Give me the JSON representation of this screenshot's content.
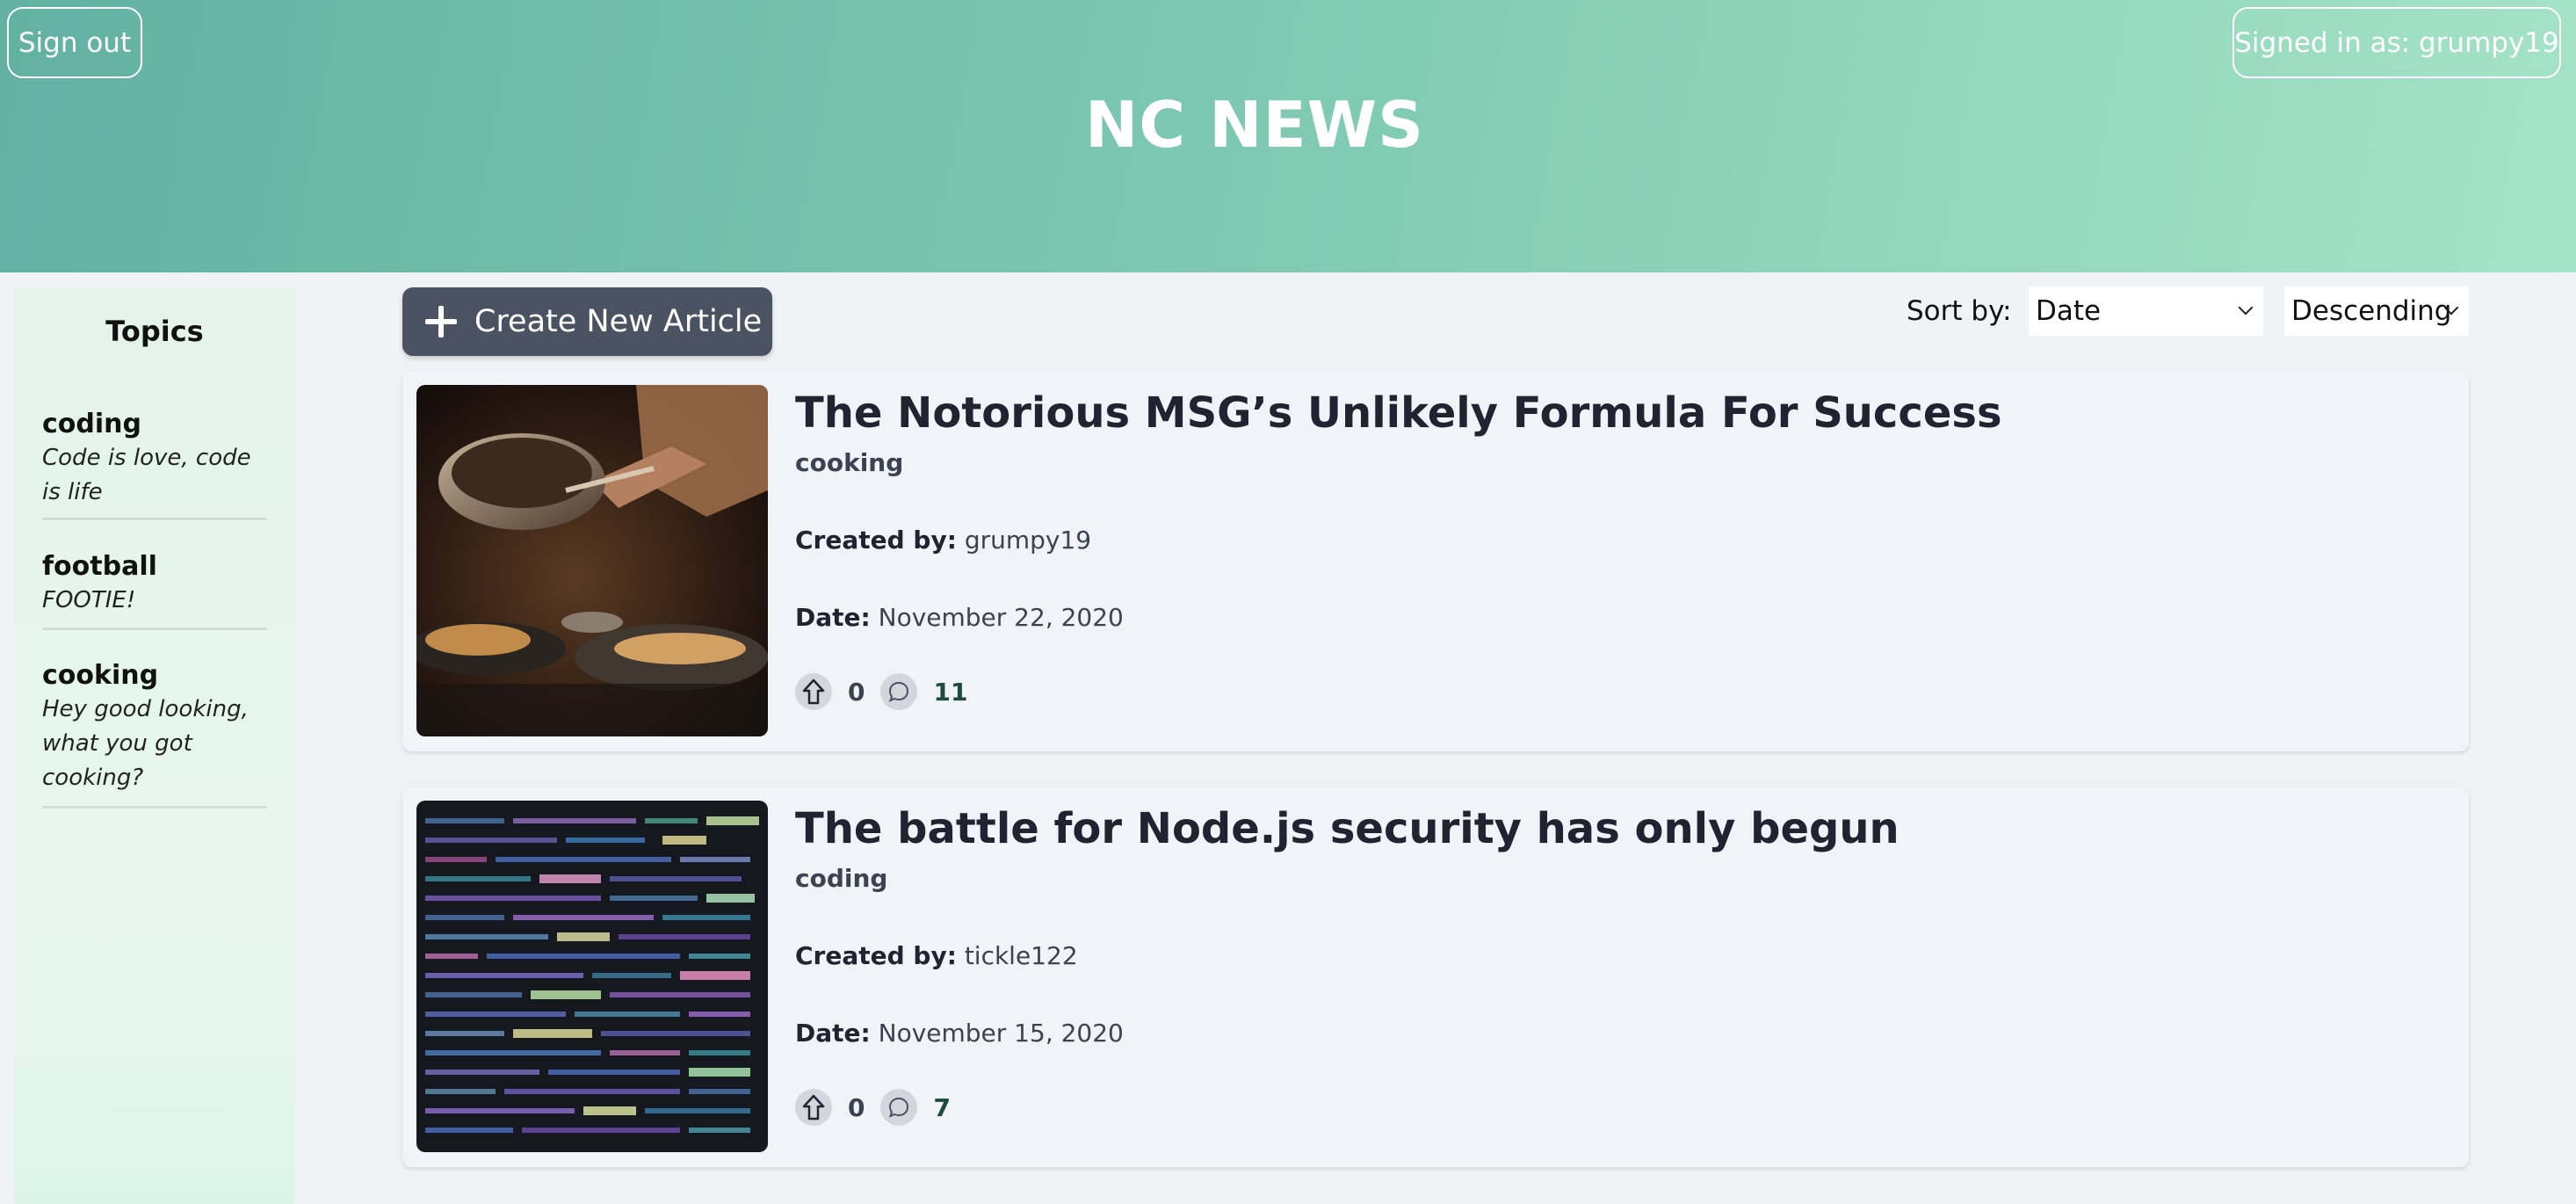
{
  "header": {
    "sign_out": "Sign out",
    "signed_in": "Signed in as: grumpy19",
    "title": "NC NEWS"
  },
  "sidebar": {
    "title": "Topics",
    "topics": [
      {
        "slug": "coding",
        "description": "Code is love, code is life"
      },
      {
        "slug": "football",
        "description": "FOOTIE!"
      },
      {
        "slug": "cooking",
        "description": "Hey good looking, what you got cooking?"
      }
    ]
  },
  "toolbar": {
    "create_label": "Create New Article",
    "sort_label": "Sort by:",
    "sort_field": "Date",
    "sort_order": "Descending"
  },
  "articles": [
    {
      "title": "The Notorious MSG’s Unlikely Formula For Success",
      "topic": "cooking",
      "created_by_label": "Created by:",
      "author": "grumpy19",
      "date_label": "Date:",
      "date": "November 22, 2020",
      "votes": "0",
      "comment_count": "11",
      "image": "cooking-photo"
    },
    {
      "title": "The battle for Node.js security has only begun",
      "topic": "coding",
      "created_by_label": "Created by:",
      "author": "tickle122",
      "date_label": "Date:",
      "date": "November 15, 2020",
      "votes": "0",
      "comment_count": "7",
      "image": "code-photo"
    }
  ]
}
